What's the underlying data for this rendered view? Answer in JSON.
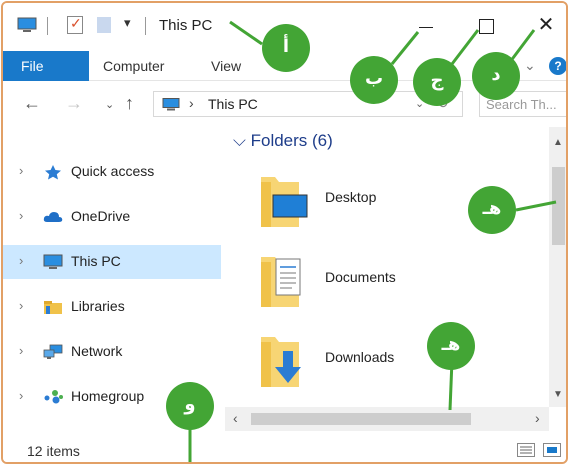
{
  "titlebar": {
    "title": "This PC",
    "dropdown_glyph": "▾",
    "close_glyph": "✕"
  },
  "ribbon": {
    "tabs": [
      "File",
      "Computer",
      "View"
    ],
    "expand_glyph": "⌄",
    "help_glyph": "?"
  },
  "addressbar": {
    "back_glyph": "←",
    "forward_glyph": "→",
    "recent_glyph": "⌄",
    "up_glyph": "↑",
    "chevron": "›",
    "path": "This PC",
    "dropdown_glyph": "⌄",
    "refresh_glyph": "↻",
    "search_placeholder": "Search Th..."
  },
  "navpane": {
    "caret": "›",
    "items": [
      {
        "label": "Quick access",
        "icon": "star-icon"
      },
      {
        "label": "OneDrive",
        "icon": "cloud-icon"
      },
      {
        "label": "This PC",
        "icon": "computer-icon",
        "selected": true
      },
      {
        "label": "Libraries",
        "icon": "libraries-icon"
      },
      {
        "label": "Network",
        "icon": "network-icon"
      },
      {
        "label": "Homegroup",
        "icon": "homegroup-icon"
      }
    ]
  },
  "content": {
    "group_header": "⌵ Folders (6)",
    "folders": [
      {
        "label": "Desktop",
        "icon": "desktop-folder-icon"
      },
      {
        "label": "Documents",
        "icon": "documents-folder-icon"
      },
      {
        "label": "Downloads",
        "icon": "downloads-folder-icon"
      }
    ]
  },
  "scrollbars": {
    "up_glyph": "▲",
    "down_glyph": "▼",
    "left_glyph": "‹",
    "right_glyph": "›"
  },
  "statusbar": {
    "item_count": "12 items"
  },
  "callouts": {
    "a": "أ",
    "b": "ب",
    "c": "ج",
    "d": "د",
    "e1": "هـ",
    "e2": "هـ",
    "f": "و"
  },
  "colors": {
    "accent": "#1979ca",
    "callout": "#43a535",
    "frame_border": "#e2a066",
    "selection": "#cce8ff",
    "folder_header": "#1e3d8a"
  }
}
